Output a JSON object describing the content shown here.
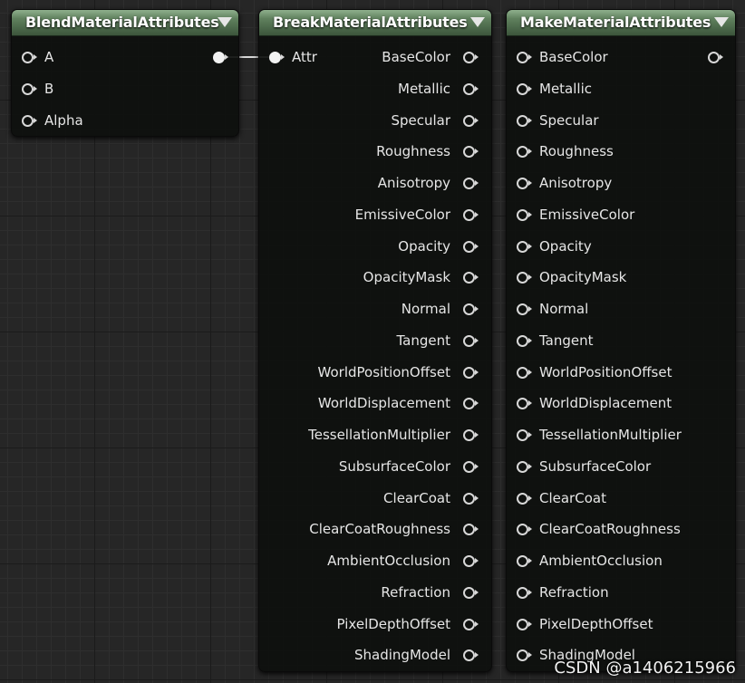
{
  "graph": {
    "nodes": {
      "blend": {
        "title": "BlendMaterialAttributes",
        "inputs": [
          "A",
          "B",
          "Alpha"
        ]
      },
      "break": {
        "title": "BreakMaterialAttributes",
        "input": "Attr",
        "outputs": [
          "BaseColor",
          "Metallic",
          "Specular",
          "Roughness",
          "Anisotropy",
          "EmissiveColor",
          "Opacity",
          "OpacityMask",
          "Normal",
          "Tangent",
          "WorldPositionOffset",
          "WorldDisplacement",
          "TessellationMultiplier",
          "SubsurfaceColor",
          "ClearCoat",
          "ClearCoatRoughness",
          "AmbientOcclusion",
          "Refraction",
          "PixelDepthOffset",
          "ShadingModel"
        ]
      },
      "make": {
        "title": "MakeMaterialAttributes",
        "inputs": [
          "BaseColor",
          "Metallic",
          "Specular",
          "Roughness",
          "Anisotropy",
          "EmissiveColor",
          "Opacity",
          "OpacityMask",
          "Normal",
          "Tangent",
          "WorldPositionOffset",
          "WorldDisplacement",
          "TessellationMultiplier",
          "SubsurfaceColor",
          "ClearCoat",
          "ClearCoatRoughness",
          "AmbientOcclusion",
          "Refraction",
          "PixelDepthOffset",
          "ShadingModel"
        ]
      }
    }
  },
  "watermark": "CSDN @a1406215966"
}
